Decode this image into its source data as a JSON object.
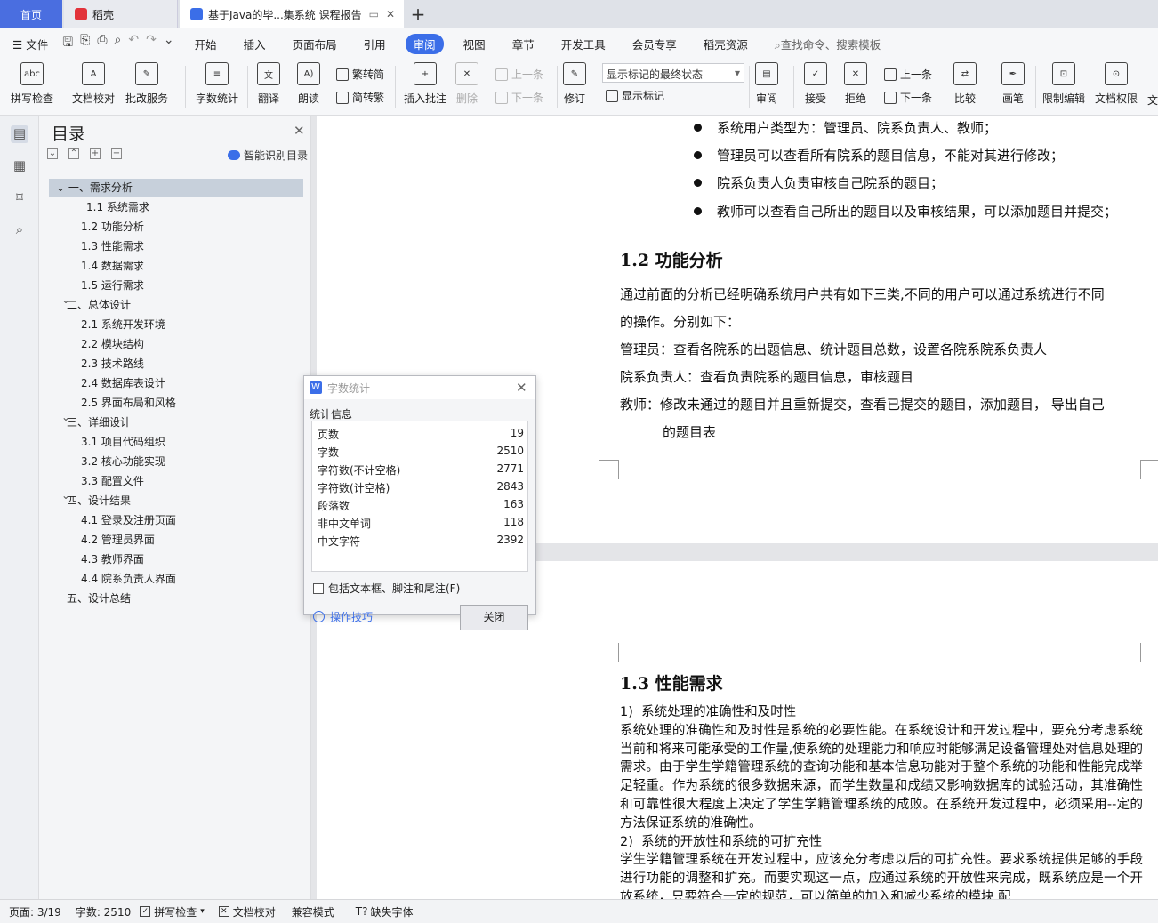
{
  "tabs": {
    "home": "首页",
    "daoke": "稻壳",
    "doc": "基于Java的毕...集系统 课程报告"
  },
  "menu": {
    "file": "文件",
    "items": [
      "开始",
      "插入",
      "页面布局",
      "引用",
      "审阅",
      "视图",
      "章节",
      "开发工具",
      "会员专享",
      "稻壳资源"
    ],
    "active": "审阅",
    "search": "查找命令、搜索模板"
  },
  "ribbon": {
    "spell": "拼写检查",
    "proof": "文档校对",
    "revise_service": "批改服务",
    "word_count": "字数统计",
    "translate": "翻译",
    "read": "朗读",
    "to_traditional": "繁转简",
    "to_simplified": "简转繁",
    "insert_comment": "插入批注",
    "delete": "删除",
    "prev": "上一条",
    "next": "下一条",
    "track": "修订",
    "mark_state": "显示标记的最终状态",
    "show_marks": "显示标记",
    "review": "审阅",
    "accept": "接受",
    "reject": "拒绝",
    "prev2": "上一条",
    "next2": "下一条",
    "compare": "比较",
    "pen": "画笔",
    "restrict": "限制编辑",
    "permission": "文档权限",
    "more": "文"
  },
  "toc": {
    "title": "目录",
    "smart": "智能识别目录",
    "items": [
      "一、需求分析",
      "1.1 系统需求",
      "1.2 功能分析",
      "1.3 性能需求",
      "1.4 数据需求",
      "1.5 运行需求",
      "二、总体设计",
      "2.1 系统开发环境",
      "2.2 模块结构",
      "2.3 技术路线",
      "2.4 数据库表设计",
      "2.5 界面布局和风格",
      "三、详细设计",
      "3.1 项目代码组织",
      "3.2 核心功能实现",
      "3.3 配置文件",
      "四、设计结果",
      "4.1 登录及注册页面",
      "4.2 管理员界面",
      "4.3 教师界面",
      "4.4 院系负责人界面",
      "五、设计总结"
    ]
  },
  "doc": {
    "bullets": [
      "系统用户类型为：管理员、院系负责人、教师；",
      "管理员可以查看所有院系的题目信息，不能对其进行修改；",
      "院系负责人负责审核自己院系的题目；",
      "教师可以查看自己所出的题目以及审核结果，可以添加题目并提交；"
    ],
    "h_func": "1.2 功能分析",
    "p1": "通过前面的分析已经明确系统用户共有如下三类,不同的用户可以通过系统进行不同",
    "p2": "的操作。分别如下：",
    "p3": "管理员：查看各院系的出题信息、统计题目总数，设置各院系院系负责人",
    "p4": "院系负责人：查看负责院系的题目信息，审核题目",
    "p5": "教师：修改未通过的题目并且重新提交，查看已提交的题目，添加题目，  导出自己",
    "p6": "的题目表",
    "h_perf": "1.3  性能需求",
    "perf": "1)  系统处理的准确性和及时性\n系统处理的准确性和及时性是系统的必要性能。在系统设计和开发过程中，要充分考虑系统当前和将来可能承受的工作量,使系统的处理能力和响应时能够满足设备管理处对信息处理的需求。由于学生学籍管理系统的查询功能和基本信息功能对于整个系统的功能和性能完成举足轻重。作为系统的很多数据来源，而学生数量和成绩又影响数据库的试验活动，其准确性和可靠性很大程度上决定了学生学籍管理系统的成败。在系统开发过程中，必须采用--定的方法保证系统的准确性。\n2)  系统的开放性和系统的可扩充性\n学生学籍管理系统在开发过程中，应该充分考虑以后的可扩充性。要求系统提供足够的手段进行功能的调整和扩充。而要实现这一点，应通过系统的开放性来完成，既系统应是一个开放系统，只要符合一定的规范，可以简单的加入和减少系统的模块,配"
  },
  "dialog": {
    "title": "字数统计",
    "section": "统计信息",
    "rows": [
      {
        "label": "页数",
        "value": "19"
      },
      {
        "label": "字数",
        "value": "2510"
      },
      {
        "label": "字符数(不计空格)",
        "value": "2771"
      },
      {
        "label": "字符数(计空格)",
        "value": "2843"
      },
      {
        "label": "段落数",
        "value": "163"
      },
      {
        "label": "非中文单词",
        "value": "118"
      },
      {
        "label": "中文字符",
        "value": "2392"
      }
    ],
    "checkbox": "包括文本框、脚注和尾注(F)",
    "tips": "操作技巧",
    "close": "关闭"
  },
  "status": {
    "page": "页面: 3/19",
    "words": "字数: 2510",
    "spell": "拼写检查",
    "proof": "文档校对",
    "compat": "兼容模式",
    "missing_font": "缺失字体"
  },
  "colors": {
    "accent": "#3b6ee8",
    "home_tab": "#4a6ee0"
  }
}
